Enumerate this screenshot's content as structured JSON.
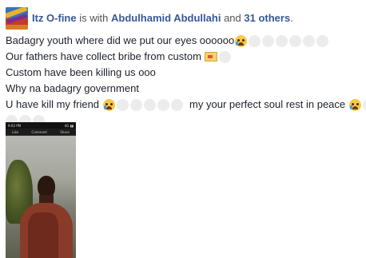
{
  "post": {
    "author": "Itz O-fine",
    "with_text": "is with",
    "tagged_person": "Abdulhamid Abdullahi",
    "and_text": "and",
    "others": "31 others",
    "period": ".",
    "lines": {
      "l1": "Badagry youth where did we put our eyes oooooo",
      "l2": "Our fathers have collect bribe from custom",
      "l3": "Custom have been killing us ooo",
      "l4": "Why na badagry government",
      "l5a": "U have kill my friend",
      "l5b": "my your perfect soul rest in peace"
    }
  },
  "photo": {
    "status_left": "9:02 PM",
    "status_right": "4G ▮▮",
    "tab_like": "Like",
    "tab_comment": "Comment",
    "tab_share": "Share"
  },
  "icons": {
    "emoji": "crying-face-icon",
    "placeholder": "unrendered-emoji-icon",
    "envelope": "envelope-money-icon"
  },
  "colors": {
    "link": "#365899",
    "text": "#1d2129",
    "emoji": "#f7c948"
  }
}
